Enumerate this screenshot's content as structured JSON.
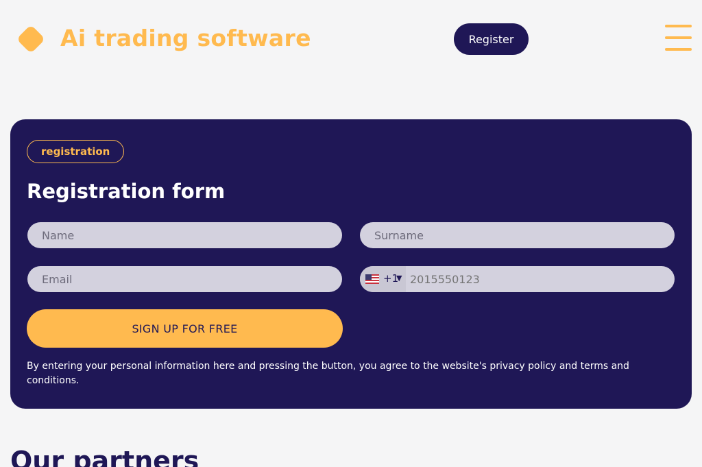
{
  "header": {
    "brand": "Ai trading software",
    "register_label": "Register",
    "logo_icon": "diamond-logo-icon",
    "menu_icon": "hamburger-menu-icon"
  },
  "form": {
    "tag": "registration",
    "title": "Registration form",
    "name_placeholder": "Name",
    "surname_placeholder": "Surname",
    "email_placeholder": "Email",
    "phone": {
      "country_flag": "us-flag-icon",
      "dial_code": "+1",
      "placeholder": "2015550123"
    },
    "submit_label": "SIGN UP FOR FREE",
    "disclaimer": "By entering your personal information here and pressing the button, you agree to the website's privacy policy and terms and conditions."
  },
  "partners": {
    "heading": "Our partners"
  },
  "colors": {
    "accent": "#ffba4f",
    "navy": "#1f1756",
    "field_bg": "#d3d1de",
    "page_bg": "#f5f5f6"
  }
}
